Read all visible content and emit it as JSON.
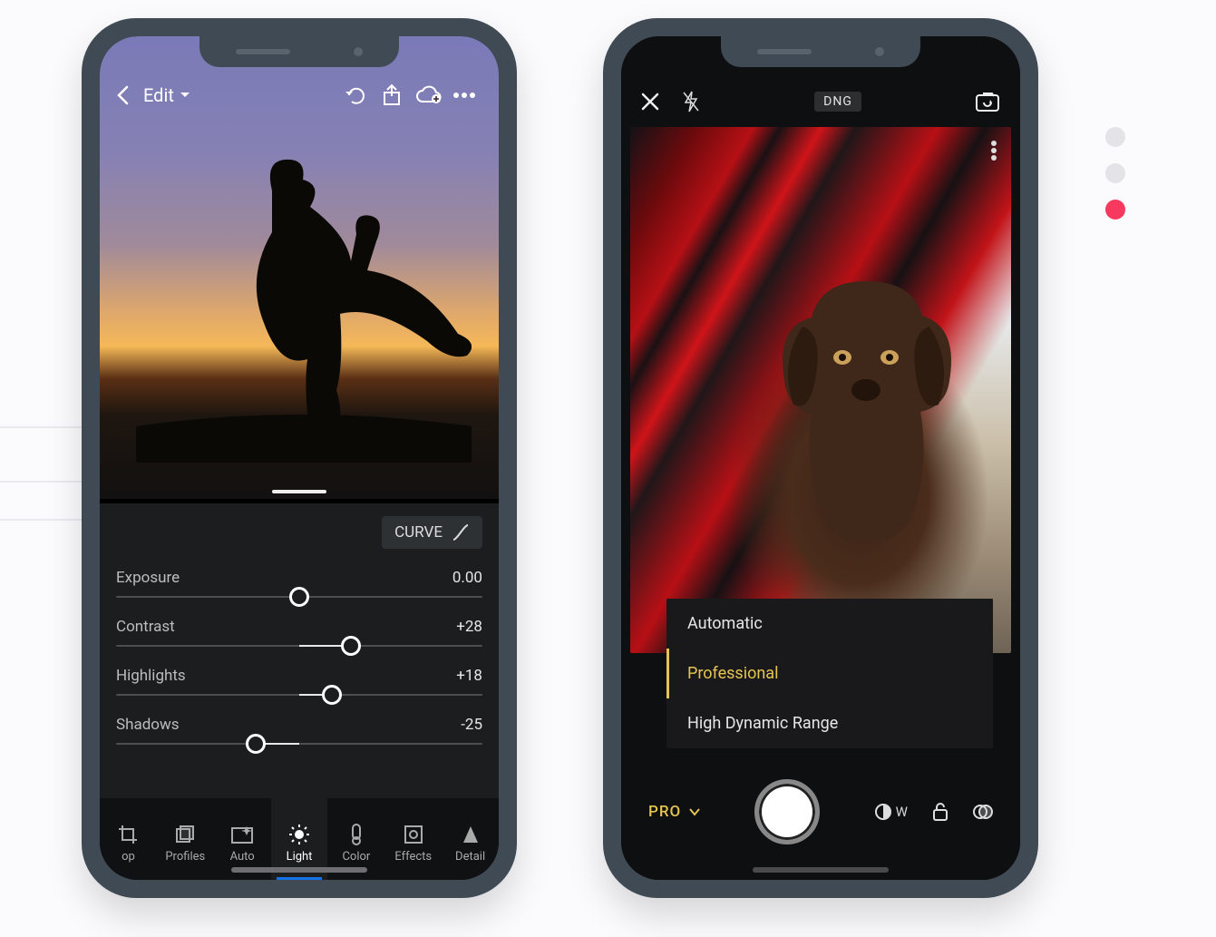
{
  "left": {
    "header": {
      "title": "Edit",
      "back_icon": "chevron-left-icon",
      "dropdown_icon": "caret-down-icon",
      "undo_icon": "undo-icon",
      "share_icon": "share-icon",
      "cloud_icon": "cloud-add-icon",
      "more_icon": "more-horizontal-icon"
    },
    "panel": {
      "curve_label": "CURVE",
      "sliders": [
        {
          "name": "Exposure",
          "value": "0.00",
          "pos": 50
        },
        {
          "name": "Contrast",
          "value": "+28",
          "pos": 64
        },
        {
          "name": "Highlights",
          "value": "+18",
          "pos": 59
        },
        {
          "name": "Shadows",
          "value": "-25",
          "pos": 38
        }
      ]
    },
    "tools": [
      {
        "label": "op",
        "icon": "crop"
      },
      {
        "label": "Profiles",
        "icon": "profiles"
      },
      {
        "label": "Auto",
        "icon": "auto"
      },
      {
        "label": "Light",
        "icon": "light",
        "active": true
      },
      {
        "label": "Color",
        "icon": "color"
      },
      {
        "label": "Effects",
        "icon": "effects"
      },
      {
        "label": "Detail",
        "icon": "detail"
      }
    ]
  },
  "right": {
    "header": {
      "close_icon": "close-icon",
      "flash_icon": "flash-off-icon",
      "format_label": "DNG",
      "switch_icon": "camera-switch-icon"
    },
    "menu": {
      "items": [
        {
          "label": "Automatic",
          "selected": false
        },
        {
          "label": "Professional",
          "selected": true
        },
        {
          "label": "High Dynamic Range",
          "selected": false
        }
      ]
    },
    "bottom": {
      "mode_label": "PRO",
      "wb_label": "W"
    }
  },
  "carousel": {
    "active_index": 2,
    "count": 3
  }
}
